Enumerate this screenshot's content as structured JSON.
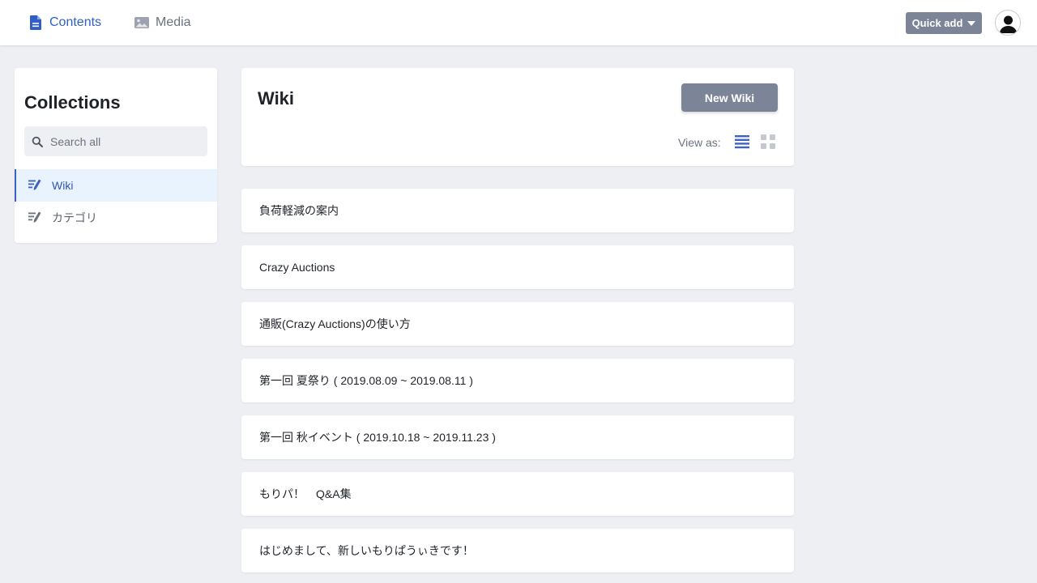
{
  "topbar": {
    "nav": [
      {
        "label": "Contents",
        "icon": "document-icon",
        "active": true
      },
      {
        "label": "Media",
        "icon": "image-icon",
        "active": false
      }
    ],
    "quick_add_label": "Quick add"
  },
  "sidebar": {
    "title": "Collections",
    "search_placeholder": "Search all",
    "items": [
      {
        "label": "Wiki",
        "icon": "collection-edit-icon",
        "active": true
      },
      {
        "label": "カテゴリ",
        "icon": "collection-edit-icon",
        "active": false
      }
    ]
  },
  "main": {
    "title": "Wiki",
    "new_button_label": "New Wiki",
    "view_as_label": "View as:",
    "view_modes": [
      "list",
      "grid"
    ],
    "active_view": "list",
    "entries": [
      "負荷軽減の案内",
      "Crazy Auctions",
      "通販(Crazy Auctions)の使い方",
      "第一回 夏祭り ( 2019.08.09 ~ 2019.08.11 )",
      "第一回 秋イベント ( 2019.10.18 ~ 2019.11.23 )",
      "もりパ！　Q&A集",
      "はじめまして、新しいもりぱうぃきです！"
    ]
  },
  "colors": {
    "accent": "#2f5fc5",
    "button_gray": "#7b8597",
    "background": "#eeeff3",
    "active_item_bg": "#e8f3fd"
  }
}
